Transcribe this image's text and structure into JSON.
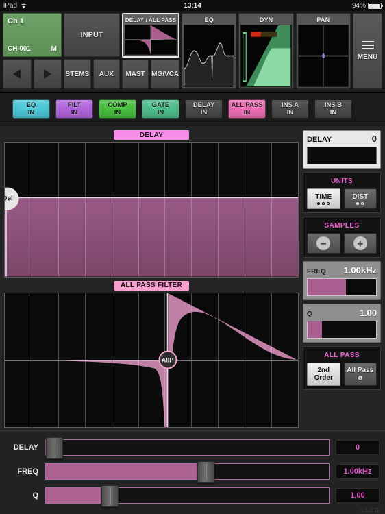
{
  "status_bar": {
    "device": "iPad",
    "wifi_icon": "wifi-icon",
    "time": "13:14",
    "battery_percent": "94%"
  },
  "channel": {
    "name": "Ch 1",
    "id": "CH 001",
    "mono_flag": "M",
    "prev_icon": "previous-channel-icon",
    "next_icon": "next-channel-icon"
  },
  "strip": {
    "input_label": "INPUT",
    "sub_buttons": [
      "STEMS",
      "AUX",
      "MAST",
      "MG/VCA"
    ],
    "thumbnails": [
      {
        "title": "DELAY / ALL PASS",
        "selected": true
      },
      {
        "title": "EQ",
        "selected": false
      },
      {
        "title": "DYN",
        "selected": false
      },
      {
        "title": "PAN",
        "selected": false
      }
    ],
    "menu_label": "MENU",
    "menu_icon": "hamburger-menu-icon"
  },
  "tabs": [
    {
      "line1": "EQ",
      "line2": "IN",
      "color": "#4cc8d8",
      "active": true
    },
    {
      "line1": "FILT",
      "line2": "IN",
      "color": "#b266dd",
      "active": true
    },
    {
      "line1": "COMP",
      "line2": "IN",
      "color": "#49c13f",
      "active": true
    },
    {
      "line1": "GATE",
      "line2": "IN",
      "color": "#4fbf8d",
      "active": true
    },
    {
      "line1": "DELAY",
      "line2": "IN",
      "color": "#4a4a4a",
      "active": false
    },
    {
      "line1": "ALL PASS",
      "line2": "IN",
      "color": "#ef6fb5",
      "active": true
    },
    {
      "line1": "INS A",
      "line2": "IN",
      "color": "#4a4a4a",
      "active": false
    },
    {
      "line1": "INS B",
      "line2": "IN",
      "color": "#4a4a4a",
      "active": false
    }
  ],
  "graphs": {
    "delay": {
      "title": "DELAY",
      "title_color": "#f58ce8",
      "handle_label": "Del",
      "grid_columns": 11,
      "curve_level_pct": 40
    },
    "allpass": {
      "title": "ALL PASS FILTER",
      "title_color": "#f5a0cd",
      "handle_label": "AllP",
      "grid_columns": 11,
      "center_x_pct": 54.5
    }
  },
  "panel": {
    "delay": {
      "label": "DELAY",
      "value": "0",
      "fill_pct": 0
    },
    "units": {
      "title": "UNITS",
      "time": {
        "label": "TIME",
        "dots": 3,
        "dots_on": 1,
        "selected": true
      },
      "dist": {
        "label": "DIST",
        "dots": 2,
        "dots_on": 1,
        "selected": false
      }
    },
    "samples": {
      "title": "SAMPLES",
      "minus_icon": "minus-circle-icon",
      "plus_icon": "plus-circle-icon",
      "minus_glyph": "−",
      "plus_glyph": "+"
    },
    "freq": {
      "label": "FREQ",
      "value": "1.00kHz",
      "fill_pct": 56
    },
    "q": {
      "label": "Q",
      "value": "1.00",
      "fill_pct": 21
    },
    "allpass": {
      "title": "ALL PASS",
      "order": {
        "line1": "2nd",
        "line2": "Order",
        "selected": true
      },
      "phase": {
        "line1": "All Pass",
        "line2": "ø",
        "selected": false
      }
    }
  },
  "sliders": [
    {
      "label": "DELAY",
      "value": "0",
      "fill_pct": 0,
      "handle_pct": 0
    },
    {
      "label": "FREQ",
      "value": "1.00kHz",
      "fill_pct": 57,
      "handle_pct": 57
    },
    {
      "label": "Q",
      "value": "1.00",
      "fill_pct": 21,
      "handle_pct": 21
    }
  ],
  "version": "v.3.0.11"
}
